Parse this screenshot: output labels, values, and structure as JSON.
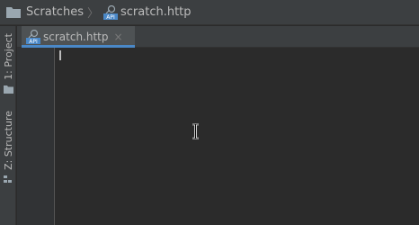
{
  "navbar": {
    "breadcrumb": [
      {
        "label": "Scratches",
        "icon": "folder-icon"
      },
      {
        "label": "scratch.http",
        "icon": "api-file-icon"
      }
    ]
  },
  "left_stripe": {
    "items": [
      {
        "label": "1: Project",
        "icon": "folder-icon"
      },
      {
        "label": "Z: Structure",
        "icon": "structure-icon"
      }
    ]
  },
  "tabs": [
    {
      "label": "scratch.http",
      "icon": "api-file-icon",
      "active": true,
      "close": "×"
    }
  ],
  "colors": {
    "accent": "#4a88c7",
    "background": "#2b2b2b",
    "panel": "#3c3f41"
  }
}
